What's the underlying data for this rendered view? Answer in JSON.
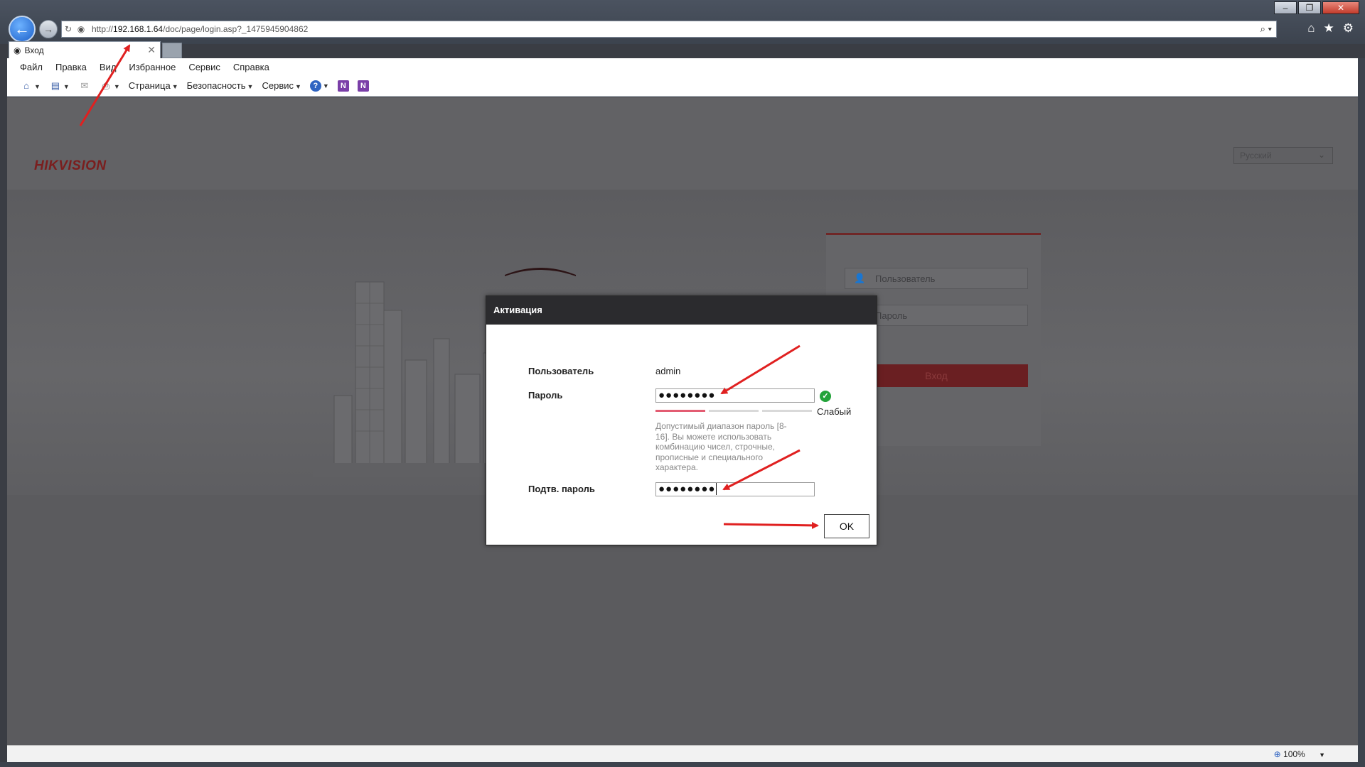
{
  "window": {
    "controls": [
      "–",
      "❐",
      "✕"
    ]
  },
  "browser": {
    "url_prefix": "http://",
    "url_host": "192.168.1.64",
    "url_path": "/doc/page/login.asp?_1475945904862",
    "tab_title": "Вход",
    "tab_close": "✕",
    "icons": {
      "back": "←",
      "forward": "→",
      "refresh": "↻",
      "search": "⌕ ▾",
      "home": "⌂",
      "favorites": "★",
      "tools": "⚙"
    }
  },
  "menu": {
    "items": [
      "Файл",
      "Правка",
      "Вид",
      "Избранное",
      "Сервис",
      "Справка"
    ]
  },
  "commandbar": {
    "page": "Страница",
    "security": "Безопасность",
    "service": "Сервис",
    "help_glyph": "?",
    "onenote_glyph": "N"
  },
  "login_page": {
    "brand": "HIKVISION",
    "language": "Русский",
    "username_placeholder": "Пользователь",
    "password_placeholder": "Пароль",
    "login_button": "Вход"
  },
  "dialog": {
    "title": "Активация",
    "user_label": "Пользователь",
    "user_value": "admin",
    "password_label": "Пароль",
    "password_value": "●●●●●●●●",
    "strength_label": "Слабый",
    "strength_level": 1,
    "strength_segments": 3,
    "hint": "Допустимый диапазон пароль [8-16]. Вы можете использовать комбинацию чисел, строчные, прописные и специального характера.",
    "confirm_label": "Подтв. пароль",
    "confirm_value": "●●●●●●●●",
    "ok_button": "OK"
  },
  "statusbar": {
    "zoom": "100%"
  },
  "colors": {
    "arrow": "#e02020",
    "brand": "#c8102e",
    "check": "#23a33a",
    "strength_weak": "#e35c72"
  }
}
